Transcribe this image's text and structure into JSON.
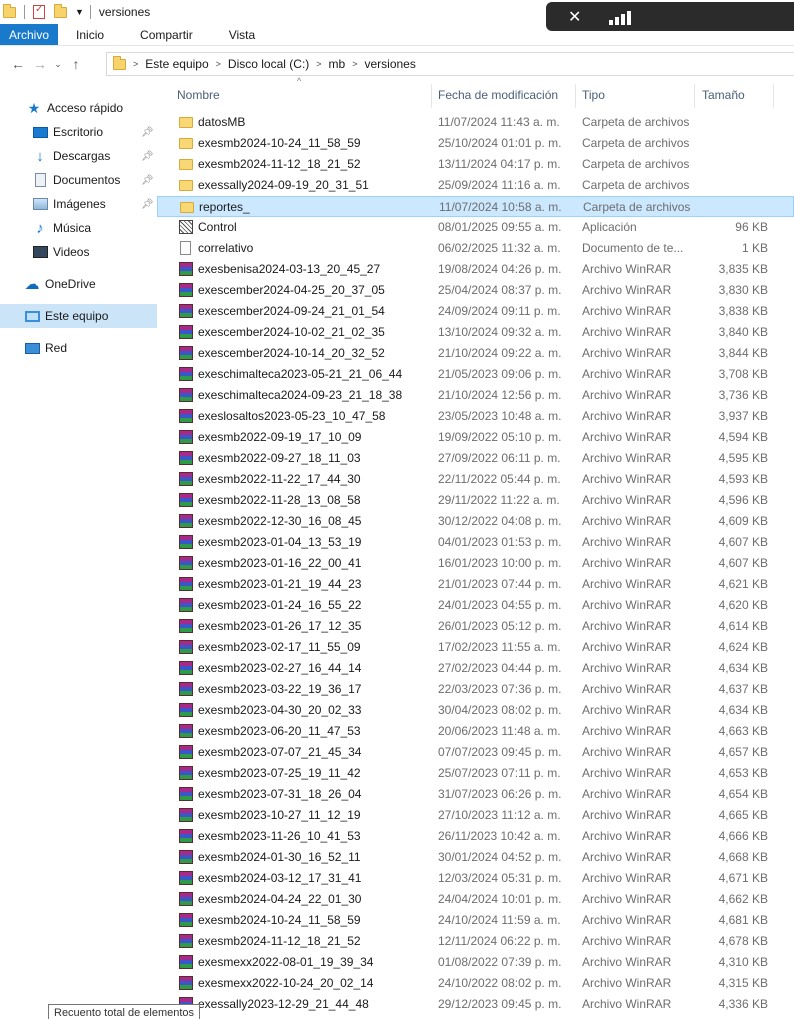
{
  "window": {
    "title": "versiones"
  },
  "ribbon": {
    "tabs": [
      "Archivo",
      "Inicio",
      "Compartir",
      "Vista"
    ]
  },
  "address": {
    "crumbs": [
      "Este equipo",
      "Disco local (C:)",
      "mb",
      "versiones"
    ]
  },
  "sidebar": {
    "items": [
      {
        "label": "Acceso rápido",
        "icon": "star-icon",
        "pinned": false
      },
      {
        "label": "Escritorio",
        "icon": "desktop-icon",
        "pinned": true
      },
      {
        "label": "Descargas",
        "icon": "download-icon",
        "pinned": true
      },
      {
        "label": "Documentos",
        "icon": "documents-icon",
        "pinned": true
      },
      {
        "label": "Imágenes",
        "icon": "pictures-icon",
        "pinned": true
      },
      {
        "label": "Música",
        "icon": "music-icon",
        "pinned": false
      },
      {
        "label": "Videos",
        "icon": "video-icon",
        "pinned": false
      },
      {
        "label": "OneDrive",
        "icon": "cloud-icon",
        "pinned": false
      },
      {
        "label": "Este equipo",
        "icon": "computer-icon",
        "pinned": false
      },
      {
        "label": "Red",
        "icon": "network-icon",
        "pinned": false
      }
    ]
  },
  "columns": {
    "name": "Nombre",
    "date": "Fecha de modificación",
    "type": "Tipo",
    "size": "Tamaño"
  },
  "files": [
    {
      "name": "datosMB",
      "date": "11/07/2024 11:43 a. m.",
      "type": "Carpeta de archivos",
      "size": "",
      "kind": "folder"
    },
    {
      "name": "exesmb2024-10-24_11_58_59",
      "date": "25/10/2024 01:01 p. m.",
      "type": "Carpeta de archivos",
      "size": "",
      "kind": "folder"
    },
    {
      "name": "exesmb2024-11-12_18_21_52",
      "date": "13/11/2024 04:17 p. m.",
      "type": "Carpeta de archivos",
      "size": "",
      "kind": "folder"
    },
    {
      "name": "exessally2024-09-19_20_31_51",
      "date": "25/09/2024 11:16 a. m.",
      "type": "Carpeta de archivos",
      "size": "",
      "kind": "folder"
    },
    {
      "name": "reportes_",
      "date": "11/07/2024 10:58 a. m.",
      "type": "Carpeta de archivos",
      "size": "",
      "kind": "folder",
      "selected": true
    },
    {
      "name": "Control",
      "date": "08/01/2025 09:55 a. m.",
      "type": "Aplicación",
      "size": "96 KB",
      "kind": "app"
    },
    {
      "name": "correlativo",
      "date": "06/02/2025 11:32 a. m.",
      "type": "Documento de te...",
      "size": "1 KB",
      "kind": "text"
    },
    {
      "name": "exesbenisa2024-03-13_20_45_27",
      "date": "19/08/2024 04:26 p. m.",
      "type": "Archivo WinRAR",
      "size": "3,835 KB",
      "kind": "rar"
    },
    {
      "name": "exescember2024-04-25_20_37_05",
      "date": "25/04/2024 08:37 p. m.",
      "type": "Archivo WinRAR",
      "size": "3,830 KB",
      "kind": "rar"
    },
    {
      "name": "exescember2024-09-24_21_01_54",
      "date": "24/09/2024 09:11 p. m.",
      "type": "Archivo WinRAR",
      "size": "3,838 KB",
      "kind": "rar"
    },
    {
      "name": "exescember2024-10-02_21_02_35",
      "date": "13/10/2024 09:32 a. m.",
      "type": "Archivo WinRAR",
      "size": "3,840 KB",
      "kind": "rar"
    },
    {
      "name": "exescember2024-10-14_20_32_52",
      "date": "21/10/2024 09:22 a. m.",
      "type": "Archivo WinRAR",
      "size": "3,844 KB",
      "kind": "rar"
    },
    {
      "name": "exeschimalteca2023-05-21_21_06_44",
      "date": "21/05/2023 09:06 p. m.",
      "type": "Archivo WinRAR",
      "size": "3,708 KB",
      "kind": "rar"
    },
    {
      "name": "exeschimalteca2024-09-23_21_18_38",
      "date": "21/10/2024 12:56 p. m.",
      "type": "Archivo WinRAR",
      "size": "3,736 KB",
      "kind": "rar"
    },
    {
      "name": "exeslosaltos2023-05-23_10_47_58",
      "date": "23/05/2023 10:48 a. m.",
      "type": "Archivo WinRAR",
      "size": "3,937 KB",
      "kind": "rar"
    },
    {
      "name": "exesmb2022-09-19_17_10_09",
      "date": "19/09/2022 05:10 p. m.",
      "type": "Archivo WinRAR",
      "size": "4,594 KB",
      "kind": "rar"
    },
    {
      "name": "exesmb2022-09-27_18_11_03",
      "date": "27/09/2022 06:11 p. m.",
      "type": "Archivo WinRAR",
      "size": "4,595 KB",
      "kind": "rar"
    },
    {
      "name": "exesmb2022-11-22_17_44_30",
      "date": "22/11/2022 05:44 p. m.",
      "type": "Archivo WinRAR",
      "size": "4,593 KB",
      "kind": "rar"
    },
    {
      "name": "exesmb2022-11-28_13_08_58",
      "date": "29/11/2022 11:22 a. m.",
      "type": "Archivo WinRAR",
      "size": "4,596 KB",
      "kind": "rar"
    },
    {
      "name": "exesmb2022-12-30_16_08_45",
      "date": "30/12/2022 04:08 p. m.",
      "type": "Archivo WinRAR",
      "size": "4,609 KB",
      "kind": "rar"
    },
    {
      "name": "exesmb2023-01-04_13_53_19",
      "date": "04/01/2023 01:53 p. m.",
      "type": "Archivo WinRAR",
      "size": "4,607 KB",
      "kind": "rar"
    },
    {
      "name": "exesmb2023-01-16_22_00_41",
      "date": "16/01/2023 10:00 p. m.",
      "type": "Archivo WinRAR",
      "size": "4,607 KB",
      "kind": "rar"
    },
    {
      "name": "exesmb2023-01-21_19_44_23",
      "date": "21/01/2023 07:44 p. m.",
      "type": "Archivo WinRAR",
      "size": "4,621 KB",
      "kind": "rar"
    },
    {
      "name": "exesmb2023-01-24_16_55_22",
      "date": "24/01/2023 04:55 p. m.",
      "type": "Archivo WinRAR",
      "size": "4,620 KB",
      "kind": "rar"
    },
    {
      "name": "exesmb2023-01-26_17_12_35",
      "date": "26/01/2023 05:12 p. m.",
      "type": "Archivo WinRAR",
      "size": "4,614 KB",
      "kind": "rar"
    },
    {
      "name": "exesmb2023-02-17_11_55_09",
      "date": "17/02/2023 11:55 a. m.",
      "type": "Archivo WinRAR",
      "size": "4,624 KB",
      "kind": "rar"
    },
    {
      "name": "exesmb2023-02-27_16_44_14",
      "date": "27/02/2023 04:44 p. m.",
      "type": "Archivo WinRAR",
      "size": "4,634 KB",
      "kind": "rar"
    },
    {
      "name": "exesmb2023-03-22_19_36_17",
      "date": "22/03/2023 07:36 p. m.",
      "type": "Archivo WinRAR",
      "size": "4,637 KB",
      "kind": "rar"
    },
    {
      "name": "exesmb2023-04-30_20_02_33",
      "date": "30/04/2023 08:02 p. m.",
      "type": "Archivo WinRAR",
      "size": "4,634 KB",
      "kind": "rar"
    },
    {
      "name": "exesmb2023-06-20_11_47_53",
      "date": "20/06/2023 11:48 a. m.",
      "type": "Archivo WinRAR",
      "size": "4,663 KB",
      "kind": "rar"
    },
    {
      "name": "exesmb2023-07-07_21_45_34",
      "date": "07/07/2023 09:45 p. m.",
      "type": "Archivo WinRAR",
      "size": "4,657 KB",
      "kind": "rar"
    },
    {
      "name": "exesmb2023-07-25_19_11_42",
      "date": "25/07/2023 07:11 p. m.",
      "type": "Archivo WinRAR",
      "size": "4,653 KB",
      "kind": "rar"
    },
    {
      "name": "exesmb2023-07-31_18_26_04",
      "date": "31/07/2023 06:26 p. m.",
      "type": "Archivo WinRAR",
      "size": "4,654 KB",
      "kind": "rar"
    },
    {
      "name": "exesmb2023-10-27_11_12_19",
      "date": "27/10/2023 11:12 a. m.",
      "type": "Archivo WinRAR",
      "size": "4,665 KB",
      "kind": "rar"
    },
    {
      "name": "exesmb2023-11-26_10_41_53",
      "date": "26/11/2023 10:42 a. m.",
      "type": "Archivo WinRAR",
      "size": "4,666 KB",
      "kind": "rar"
    },
    {
      "name": "exesmb2024-01-30_16_52_11",
      "date": "30/01/2024 04:52 p. m.",
      "type": "Archivo WinRAR",
      "size": "4,668 KB",
      "kind": "rar"
    },
    {
      "name": "exesmb2024-03-12_17_31_41",
      "date": "12/03/2024 05:31 p. m.",
      "type": "Archivo WinRAR",
      "size": "4,671 KB",
      "kind": "rar"
    },
    {
      "name": "exesmb2024-04-24_22_01_30",
      "date": "24/04/2024 10:01 p. m.",
      "type": "Archivo WinRAR",
      "size": "4,662 KB",
      "kind": "rar"
    },
    {
      "name": "exesmb2024-10-24_11_58_59",
      "date": "24/10/2024 11:59 a. m.",
      "type": "Archivo WinRAR",
      "size": "4,681 KB",
      "kind": "rar"
    },
    {
      "name": "exesmb2024-11-12_18_21_52",
      "date": "12/11/2024 06:22 p. m.",
      "type": "Archivo WinRAR",
      "size": "4,678 KB",
      "kind": "rar"
    },
    {
      "name": "exesmexx2022-08-01_19_39_34",
      "date": "01/08/2022 07:39 p. m.",
      "type": "Archivo WinRAR",
      "size": "4,310 KB",
      "kind": "rar"
    },
    {
      "name": "exesmexx2022-10-24_20_02_14",
      "date": "24/10/2022 08:02 p. m.",
      "type": "Archivo WinRAR",
      "size": "4,315 KB",
      "kind": "rar"
    },
    {
      "name": "exessally2023-12-29_21_44_48",
      "date": "29/12/2023 09:45 p. m.",
      "type": "Archivo WinRAR",
      "size": "4,336 KB",
      "kind": "rar"
    }
  ],
  "tooltip": {
    "text": "Recuento total de elementos"
  }
}
